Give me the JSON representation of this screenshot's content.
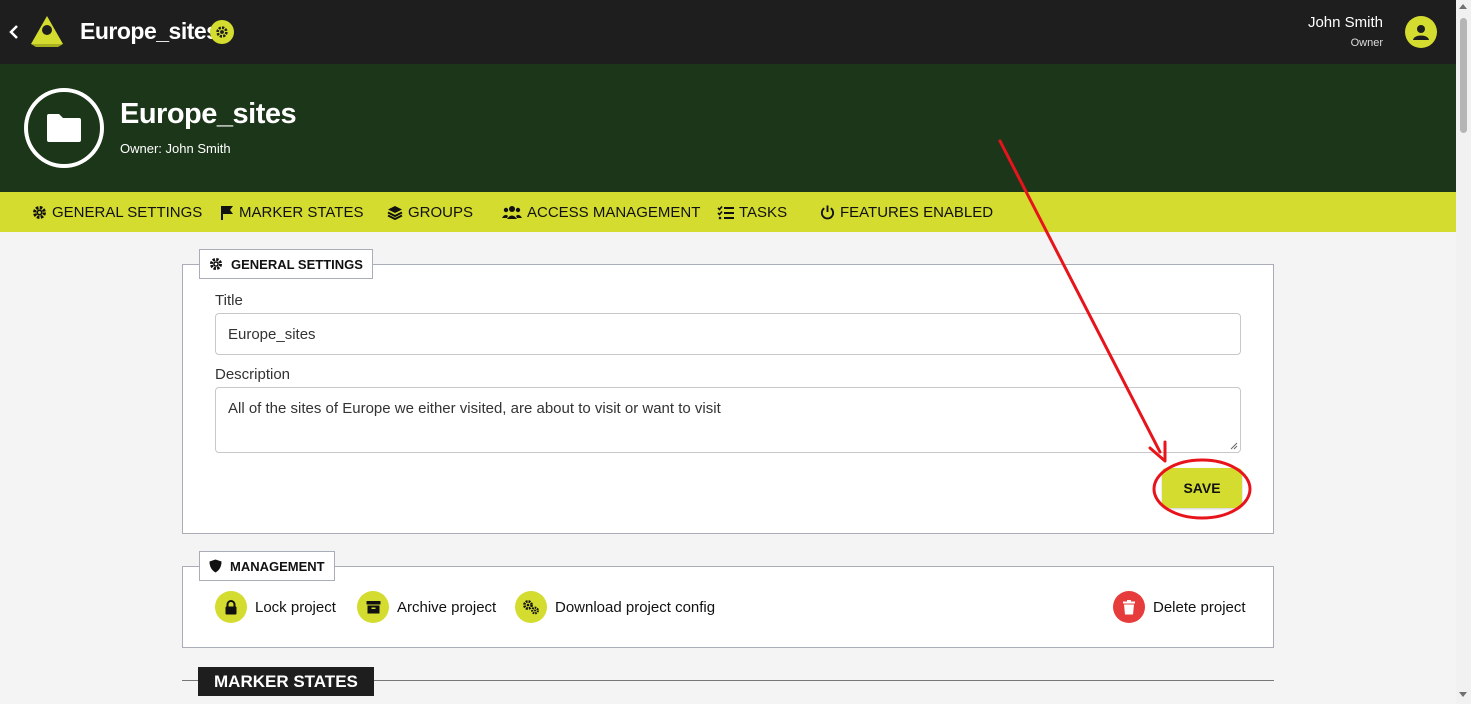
{
  "topbar": {
    "app_title": "Europe_sites",
    "user_name": "John Smith",
    "user_role": "Owner"
  },
  "hero": {
    "title": "Europe_sites",
    "owner_line": "Owner: John Smith"
  },
  "tabs": [
    {
      "label": "GENERAL SETTINGS",
      "icon": "gear-icon"
    },
    {
      "label": "MARKER STATES",
      "icon": "flag-icon"
    },
    {
      "label": "GROUPS",
      "icon": "layers-icon"
    },
    {
      "label": "ACCESS MANAGEMENT",
      "icon": "users-icon"
    },
    {
      "label": "TASKS",
      "icon": "checklist-icon"
    },
    {
      "label": "FEATURES ENABLED",
      "icon": "power-icon"
    }
  ],
  "general_settings": {
    "legend": "GENERAL SETTINGS",
    "title_label": "Title",
    "title_value": "Europe_sites",
    "description_label": "Description",
    "description_value": "All of the sites of Europe we either visited, are about to visit or want to visit",
    "save_label": "SAVE"
  },
  "management": {
    "legend": "MANAGEMENT",
    "items": [
      {
        "label": "Lock project",
        "icon": "lock-icon"
      },
      {
        "label": "Archive project",
        "icon": "archive-icon"
      },
      {
        "label": "Download project config",
        "icon": "gears-icon"
      },
      {
        "label": "Delete project",
        "icon": "trash-icon"
      }
    ]
  },
  "marker_states": {
    "heading": "MARKER STATES"
  },
  "colors": {
    "accent": "#d4dc2f",
    "topbar": "#1e1e1e",
    "hero": "#1c3619",
    "danger": "#e63c3c",
    "annotation": "#e8141b"
  }
}
